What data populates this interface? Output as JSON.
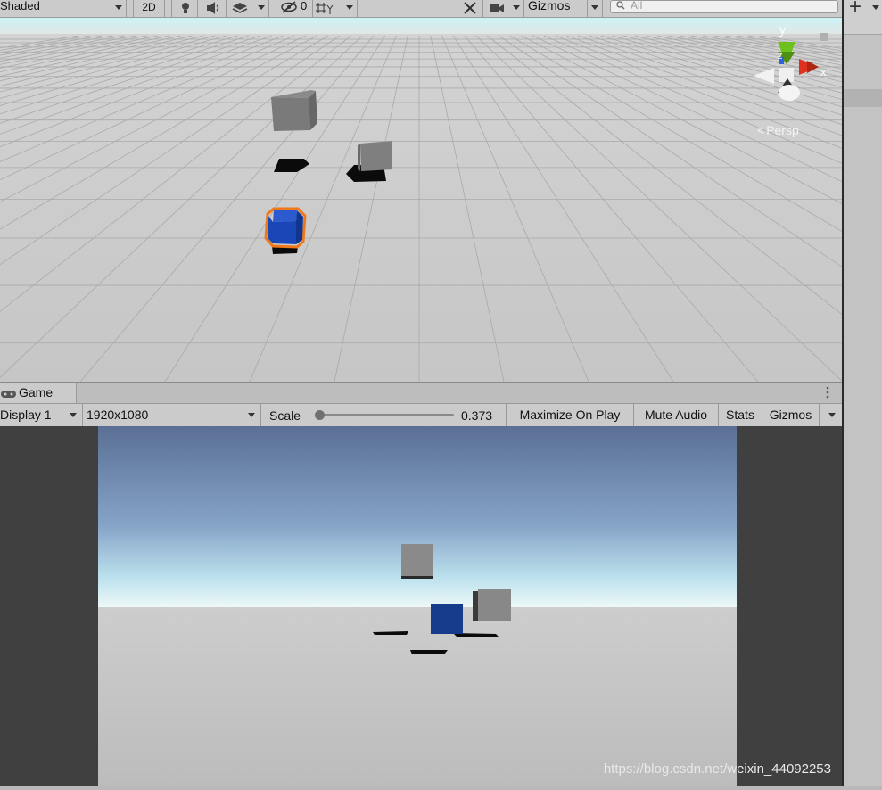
{
  "scene_toolbar": {
    "shading_mode": "Shaded",
    "mode_2d": "2D",
    "hidden_count": "0",
    "gizmos_label": "Gizmos",
    "search_placeholder": "All"
  },
  "scene_view": {
    "projection_label": "Persp",
    "axis_x": "x",
    "axis_y": "y",
    "axis_z": "z"
  },
  "game_panel": {
    "tab_label": "Game",
    "display": "Display 1",
    "resolution": "1920x1080",
    "scale_label": "Scale",
    "scale_value": "0.373",
    "scale_fraction": 0.02,
    "maximize_label": "Maximize On Play",
    "mute_label": "Mute Audio",
    "stats_label": "Stats",
    "gizmos_label": "Gizmos"
  },
  "right_panel": {
    "add_label": "+"
  },
  "watermark": "https://blog.csdn.net/weixin_44092253",
  "colors": {
    "selection_outline": "#f07818",
    "blue_cube": "#1a47b8",
    "axis_x": "#e0301e",
    "axis_y": "#6cc11c",
    "axis_z": "#2f62d8"
  }
}
